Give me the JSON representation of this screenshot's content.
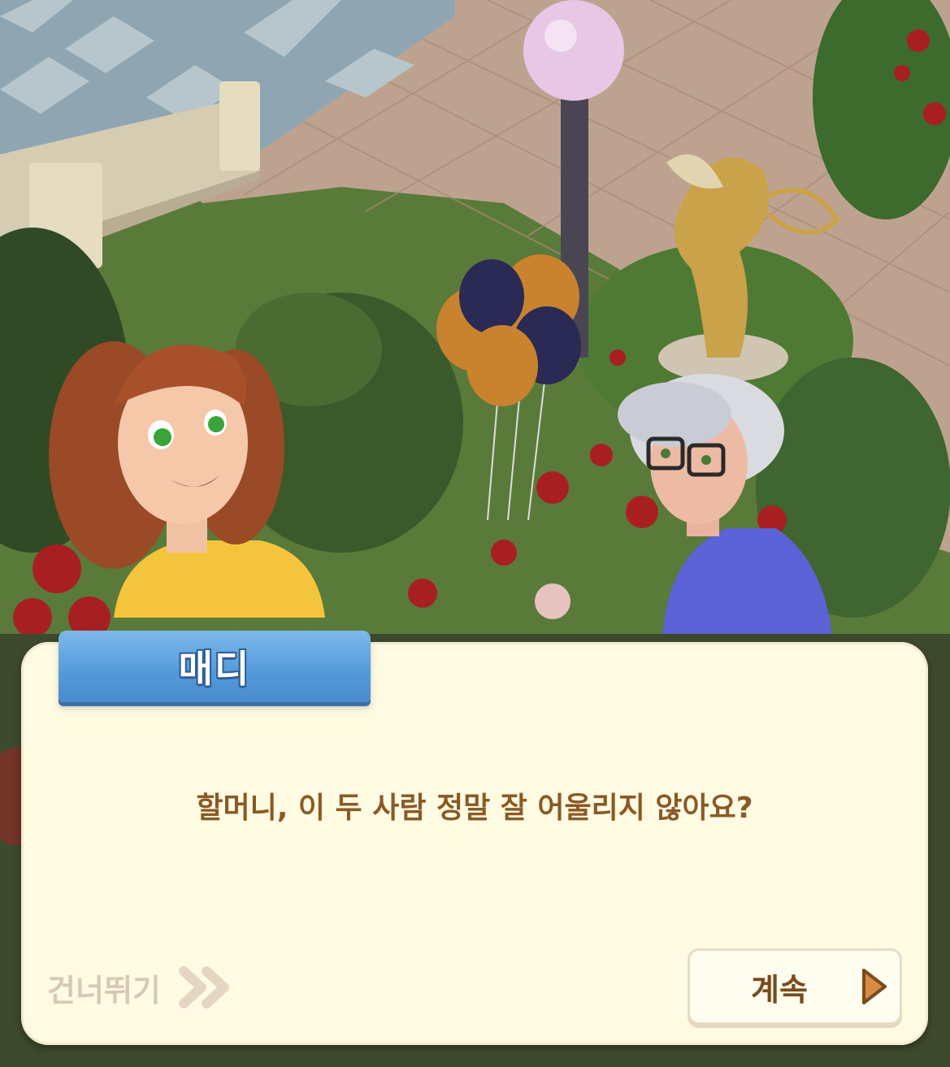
{
  "speaker": {
    "name": "매디"
  },
  "dialog": {
    "line": "할머니, 이 두 사람 정말 잘 어울리지 않아요?"
  },
  "controls": {
    "skip_label": "건너뛰기",
    "continue_label": "계속"
  },
  "icons": {
    "skip": "double-chevron-right-icon",
    "continue": "play-triangle-icon"
  },
  "colors": {
    "dialog_bg": "#fffbe3",
    "name_tab": "#5399d9",
    "dialog_text": "#8a5a26",
    "continue_text": "#7a4b1c",
    "skip_text": "#d8c9b4",
    "accent_orange": "#d98a45"
  }
}
